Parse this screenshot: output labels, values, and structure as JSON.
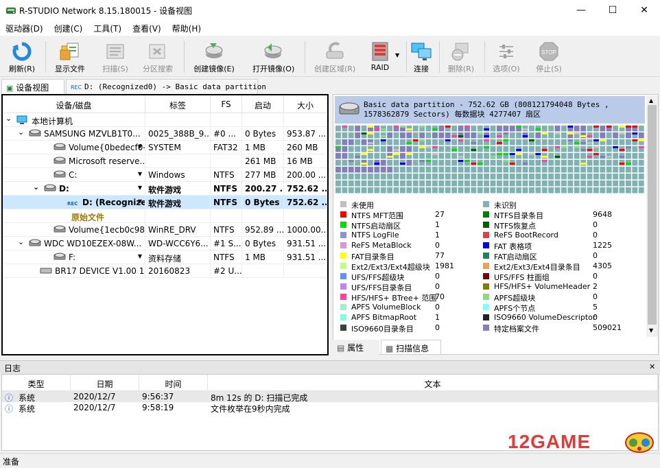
{
  "window": {
    "title": "R-STUDIO Network 8.15.180015 - 设备视图",
    "minimize": "—",
    "maximize": "☐",
    "close": "✕"
  },
  "menu": [
    "驱动器(D)",
    "创建(C)",
    "工具(T)",
    "查看(V)",
    "帮助(H)"
  ],
  "toolbar": [
    {
      "label": "刷新(R)",
      "icon": "refresh-icon"
    },
    {
      "label": "显示文件",
      "icon": "show-files-icon"
    },
    {
      "label": "扫描(S)",
      "icon": "scan-icon"
    },
    {
      "label": "分区搜索",
      "icon": "partition-search-icon"
    },
    {
      "label": "创建镜像(E)",
      "icon": "create-image-icon"
    },
    {
      "label": "打开镜像(O)",
      "icon": "open-image-icon"
    },
    {
      "label": "创建区域(R)",
      "icon": "create-region-icon"
    },
    {
      "label": "RAID",
      "icon": "raid-icon"
    },
    {
      "label": "连接",
      "icon": "connect-icon"
    },
    {
      "label": "删除(R)",
      "icon": "delete-icon"
    },
    {
      "label": "选项(O)",
      "icon": "options-icon"
    },
    {
      "label": "停止(S)",
      "icon": "stop-icon"
    }
  ],
  "tabs": {
    "device_view": "设备视图",
    "partition": "D: (Recognized0) -> Basic data partition"
  },
  "tree": {
    "columns": [
      "设备/磁盘",
      "标签",
      "FS",
      "启动",
      "大小"
    ],
    "rows": [
      {
        "name": "本地计算机",
        "label": "",
        "fs": "",
        "start": "",
        "size": ""
      },
      {
        "name": "SAMSUNG MZVLB1T0...",
        "label": "0025_388B_9...",
        "fs": "#0 ...",
        "start": "0 Bytes",
        "size": "953.87 ..."
      },
      {
        "name": "Volume{0bedecf0-...",
        "label": "SYSTEM",
        "fs": "FAT32",
        "start": "1 MB",
        "size": "260 MB"
      },
      {
        "name": "Microsoft reserve...",
        "label": "",
        "fs": "",
        "start": "261 MB",
        "size": "16 MB"
      },
      {
        "name": "C:",
        "label": "Windows",
        "fs": "NTFS",
        "start": "277 MB",
        "size": "200.00 ..."
      },
      {
        "name": "D:",
        "label": "软件游戏",
        "fs": "NTFS",
        "start": "200.27 ...",
        "size": "752.62 ..."
      },
      {
        "name": "D: (Recognize...",
        "label": "软件游戏",
        "fs": "NTFS",
        "start": "0 Bytes",
        "size": "752.62 ..."
      },
      {
        "name": "原始文件",
        "label": "",
        "fs": "",
        "start": "",
        "size": ""
      },
      {
        "name": "Volume{1ecb0c98-...",
        "label": "WinRE_DRV",
        "fs": "NTFS",
        "start": "952.89 ...",
        "size": "1000.00..."
      },
      {
        "name": "WDC WD10EZEX-08W...",
        "label": "WD-WCC6Y6...",
        "fs": "#1 S...",
        "start": "0 Bytes",
        "size": "931.51 ..."
      },
      {
        "name": "F:",
        "label": "资料存储",
        "fs": "NTFS",
        "start": "1 MB",
        "size": "931.51 ..."
      },
      {
        "name": "BR17 DEVICE V1.00 1...",
        "label": "20160823",
        "fs": "#2 U...",
        "start": "",
        "size": ""
      }
    ],
    "rec_badge": "REC"
  },
  "scan": {
    "header": "Basic data partition - 752.62 GB (808121794048 Bytes , 1578362879 Sectors) 每数据块 4277407 扇区",
    "legend": [
      {
        "name": "未使用",
        "count": "",
        "color": "#c0c0c0"
      },
      {
        "name": "未识别",
        "count": "",
        "color": "#7fb2b2"
      },
      {
        "name": "NTFS MFT范围",
        "count": "27",
        "color": "#ff0000"
      },
      {
        "name": "NTFS目录条目",
        "count": "9648",
        "color": "#008000"
      },
      {
        "name": "NTFS启动扇区",
        "count": "1",
        "color": "#00e000"
      },
      {
        "name": "NTFS恢复点",
        "count": "0",
        "color": "#006000"
      },
      {
        "name": "NTFS LogFile",
        "count": "1",
        "color": "#9090e0"
      },
      {
        "name": "ReFS BootRecord",
        "count": "0",
        "color": "#e04040"
      },
      {
        "name": "ReFS MetaBlock",
        "count": "0",
        "color": "#e090e0"
      },
      {
        "name": "FAT 表格项",
        "count": "1225",
        "color": "#0000ff"
      },
      {
        "name": "FAT目录条目",
        "count": "77",
        "color": "#ffff00"
      },
      {
        "name": "FAT启动扇区",
        "count": "0",
        "color": "#208060"
      },
      {
        "name": "Ext2/Ext3/Ext4超级块",
        "count": "1981",
        "color": "#c0ff80"
      },
      {
        "name": "Ext2/Ext3/Ext4目录条目",
        "count": "4305",
        "color": "#f0a050"
      },
      {
        "name": "UFS/FFS超级块",
        "count": "0",
        "color": "#6090ff"
      },
      {
        "name": "UFS/FFS 柱面组",
        "count": "0",
        "color": "#800000"
      },
      {
        "name": "UFS/FFS目录条目",
        "count": "0",
        "color": "#c080ff"
      },
      {
        "name": "HFS/HFS+ VolumeHeader",
        "count": "2",
        "color": "#808000"
      },
      {
        "name": "HFS/HFS+ BTree+ 范围",
        "count": "70",
        "color": "#ff40a0"
      },
      {
        "name": "APFS超级块",
        "count": "0",
        "color": "#80e080"
      },
      {
        "name": "APFS VolumeBlock",
        "count": "0",
        "color": "#a0f0d0"
      },
      {
        "name": "APFS个节点",
        "count": "5",
        "color": "#80ffff"
      },
      {
        "name": "APFS BitmapRoot",
        "count": "1",
        "color": "#80ffe0"
      },
      {
        "name": "ISO9660 VolumeDescriptor",
        "count": "0",
        "color": "#202020"
      },
      {
        "name": "ISO9660目录条目",
        "count": "0",
        "color": "#404040"
      },
      {
        "name": "特定档案文件",
        "count": "509021",
        "color": "#8080c0"
      }
    ],
    "tabs": [
      "属性",
      "扫描信息"
    ]
  },
  "log": {
    "title": "日志",
    "columns": [
      "类型",
      "日期",
      "时间",
      "文本"
    ],
    "rows": [
      {
        "type": "系统",
        "date": "2020/12/7",
        "time": "9:56:37",
        "text": "8m 12s 的 D: 扫描已完成"
      },
      {
        "type": "系统",
        "date": "2020/12/7",
        "time": "9:58:19",
        "text": "文件枚举在9秒内完成"
      }
    ]
  },
  "status": "准备",
  "watermark": "12GAME"
}
